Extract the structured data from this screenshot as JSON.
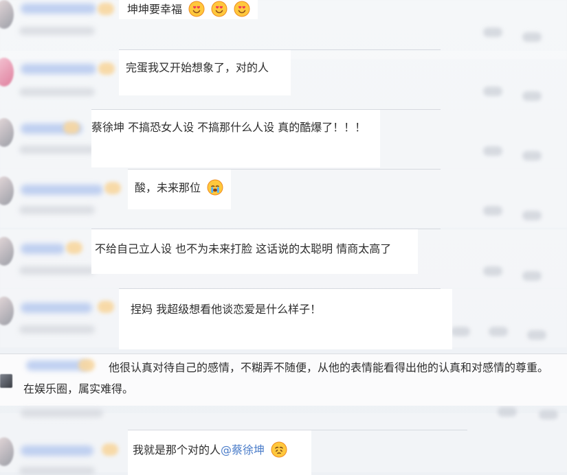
{
  "comments": [
    {
      "text": "坤坤要幸福",
      "emojis": [
        "heart-eyes-icon",
        "heart-eyes-icon",
        "heart-eyes-icon"
      ]
    },
    {
      "text": "完蛋我又开始想象了，对的人"
    },
    {
      "text": "蔡徐坤 不搞恐女人设 不搞那什么人设 真的酷爆了！！！"
    },
    {
      "text": "酸，未来那位",
      "emoji": "crying-face-icon"
    },
    {
      "text": "不给自己立人设 也不为未来打脸 这话说的太聪明 情商太高了"
    },
    {
      "text": "捏妈 我超级想看他谈恋爱是什么样子！"
    },
    {
      "text_line1": "他很认真对待自己的感情，不糊弄不随便，从他的表情能看得出他的认真和对感情的尊重。",
      "text_line2": "在娱乐圈，属实难得。"
    },
    {
      "text_prefix": "我就是那个对的人",
      "mention": "@蔡徐坤",
      "emoji": "pleading-face-icon"
    }
  ],
  "colors": {
    "mention": "#4a7cc9",
    "background": "#f0f2f5",
    "comment_bg": "#ffffff"
  }
}
